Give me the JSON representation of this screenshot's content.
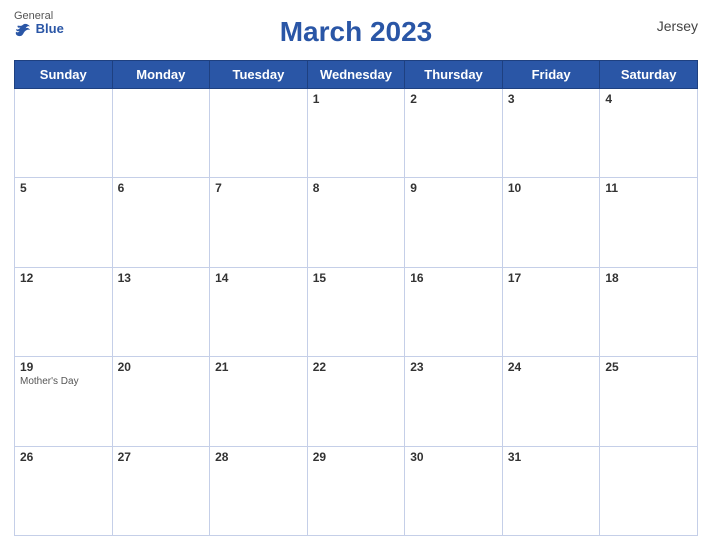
{
  "header": {
    "title": "March 2023",
    "region": "Jersey",
    "logo_general": "General",
    "logo_blue": "Blue"
  },
  "days_of_week": [
    "Sunday",
    "Monday",
    "Tuesday",
    "Wednesday",
    "Thursday",
    "Friday",
    "Saturday"
  ],
  "weeks": [
    [
      {
        "num": "",
        "event": ""
      },
      {
        "num": "",
        "event": ""
      },
      {
        "num": "",
        "event": ""
      },
      {
        "num": "1",
        "event": ""
      },
      {
        "num": "2",
        "event": ""
      },
      {
        "num": "3",
        "event": ""
      },
      {
        "num": "4",
        "event": ""
      }
    ],
    [
      {
        "num": "5",
        "event": ""
      },
      {
        "num": "6",
        "event": ""
      },
      {
        "num": "7",
        "event": ""
      },
      {
        "num": "8",
        "event": ""
      },
      {
        "num": "9",
        "event": ""
      },
      {
        "num": "10",
        "event": ""
      },
      {
        "num": "11",
        "event": ""
      }
    ],
    [
      {
        "num": "12",
        "event": ""
      },
      {
        "num": "13",
        "event": ""
      },
      {
        "num": "14",
        "event": ""
      },
      {
        "num": "15",
        "event": ""
      },
      {
        "num": "16",
        "event": ""
      },
      {
        "num": "17",
        "event": ""
      },
      {
        "num": "18",
        "event": ""
      }
    ],
    [
      {
        "num": "19",
        "event": "Mother's Day"
      },
      {
        "num": "20",
        "event": ""
      },
      {
        "num": "21",
        "event": ""
      },
      {
        "num": "22",
        "event": ""
      },
      {
        "num": "23",
        "event": ""
      },
      {
        "num": "24",
        "event": ""
      },
      {
        "num": "25",
        "event": ""
      }
    ],
    [
      {
        "num": "26",
        "event": ""
      },
      {
        "num": "27",
        "event": ""
      },
      {
        "num": "28",
        "event": ""
      },
      {
        "num": "29",
        "event": ""
      },
      {
        "num": "30",
        "event": ""
      },
      {
        "num": "31",
        "event": ""
      },
      {
        "num": "",
        "event": ""
      }
    ]
  ]
}
